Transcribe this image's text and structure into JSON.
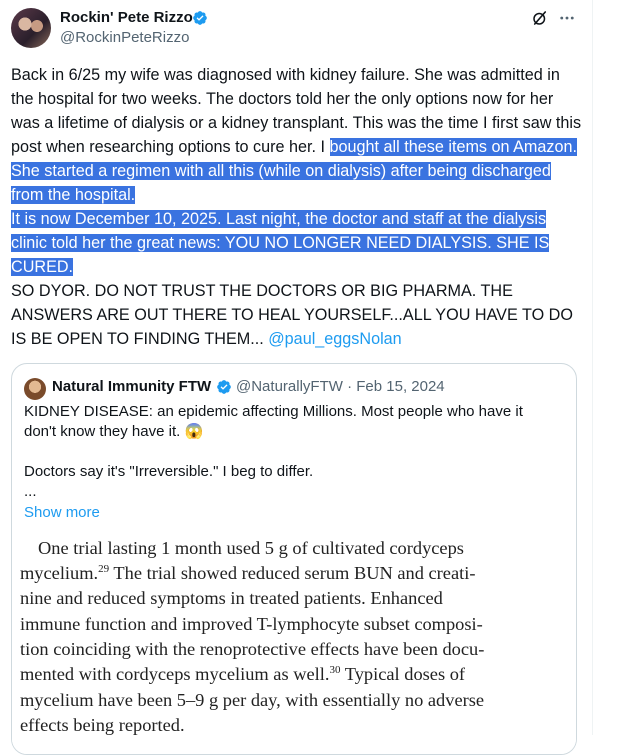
{
  "author": {
    "display_name": "Rockin' Pete Rizzo",
    "handle": "@RockinPeteRizzo"
  },
  "tweet": {
    "para1": "Back in 6/25 my wife was diagnosed with kidney failure. She was admitted in the hospital for two weeks. The doctors told her the only options now for her was a lifetime of dialysis or a kidney transplant. This was the time I first saw this post when researching options to cure her. I",
    "hl_para1_tail": "bought all these items on Amazon. She started a regimen with all this (while on dialysis) after being discharged from the hospital.",
    "hl_para2": "It is now December 10, 2025. Last night, the doctor and staff at the dialysis clinic told her the great news: YOU NO LONGER NEED DIALYSIS. SHE IS CURED.",
    "para3": "SO DYOR. DO NOT TRUST THE DOCTORS OR BIG PHARMA. THE ANSWERS ARE OUT THERE TO HEAL YOURSELF...ALL YOU HAVE TO DO IS BE OPEN TO FINDING THEM...",
    "mention": "@paul_eggsNolan"
  },
  "quote": {
    "display_name": "Natural Immunity FTW",
    "handle": "@NaturallyFTW",
    "separator": "·",
    "date": "Feb 15, 2024",
    "line1": "KIDNEY DISEASE: an epidemic affecting Millions. Most people who have it don't know they have it. 😱",
    "line2": "Doctors say it's \"Irreversible.\" I beg to differ.",
    "ellipsis": "...",
    "show_more": "Show more",
    "image_text": {
      "l1": "One trial lasting 1 month used 5 g of cultivated cordyceps",
      "l2a": "mycelium.",
      "l2sup": "29",
      "l2b": " The trial showed reduced serum BUN and creati-",
      "l3": "nine and reduced symptoms in treated patients. Enhanced",
      "l4": "immune function and improved T-lymphocyte subset composi-",
      "l5": "tion coinciding with the renoprotective effects have been docu-",
      "l6a": "mented with cordyceps mycelium as well.",
      "l6sup": "30",
      "l6b": " Typical doses of",
      "l7": "mycelium have been 5–9 g per day, with essentially no adverse",
      "l8": "effects being reported."
    }
  },
  "icons": {
    "verified": "verified-badge-icon",
    "grok": "grok-icon",
    "more": "more-options-icon"
  },
  "colors": {
    "accent": "#1d9bf0",
    "highlight": "#3a73e0",
    "muted": "#536471"
  }
}
